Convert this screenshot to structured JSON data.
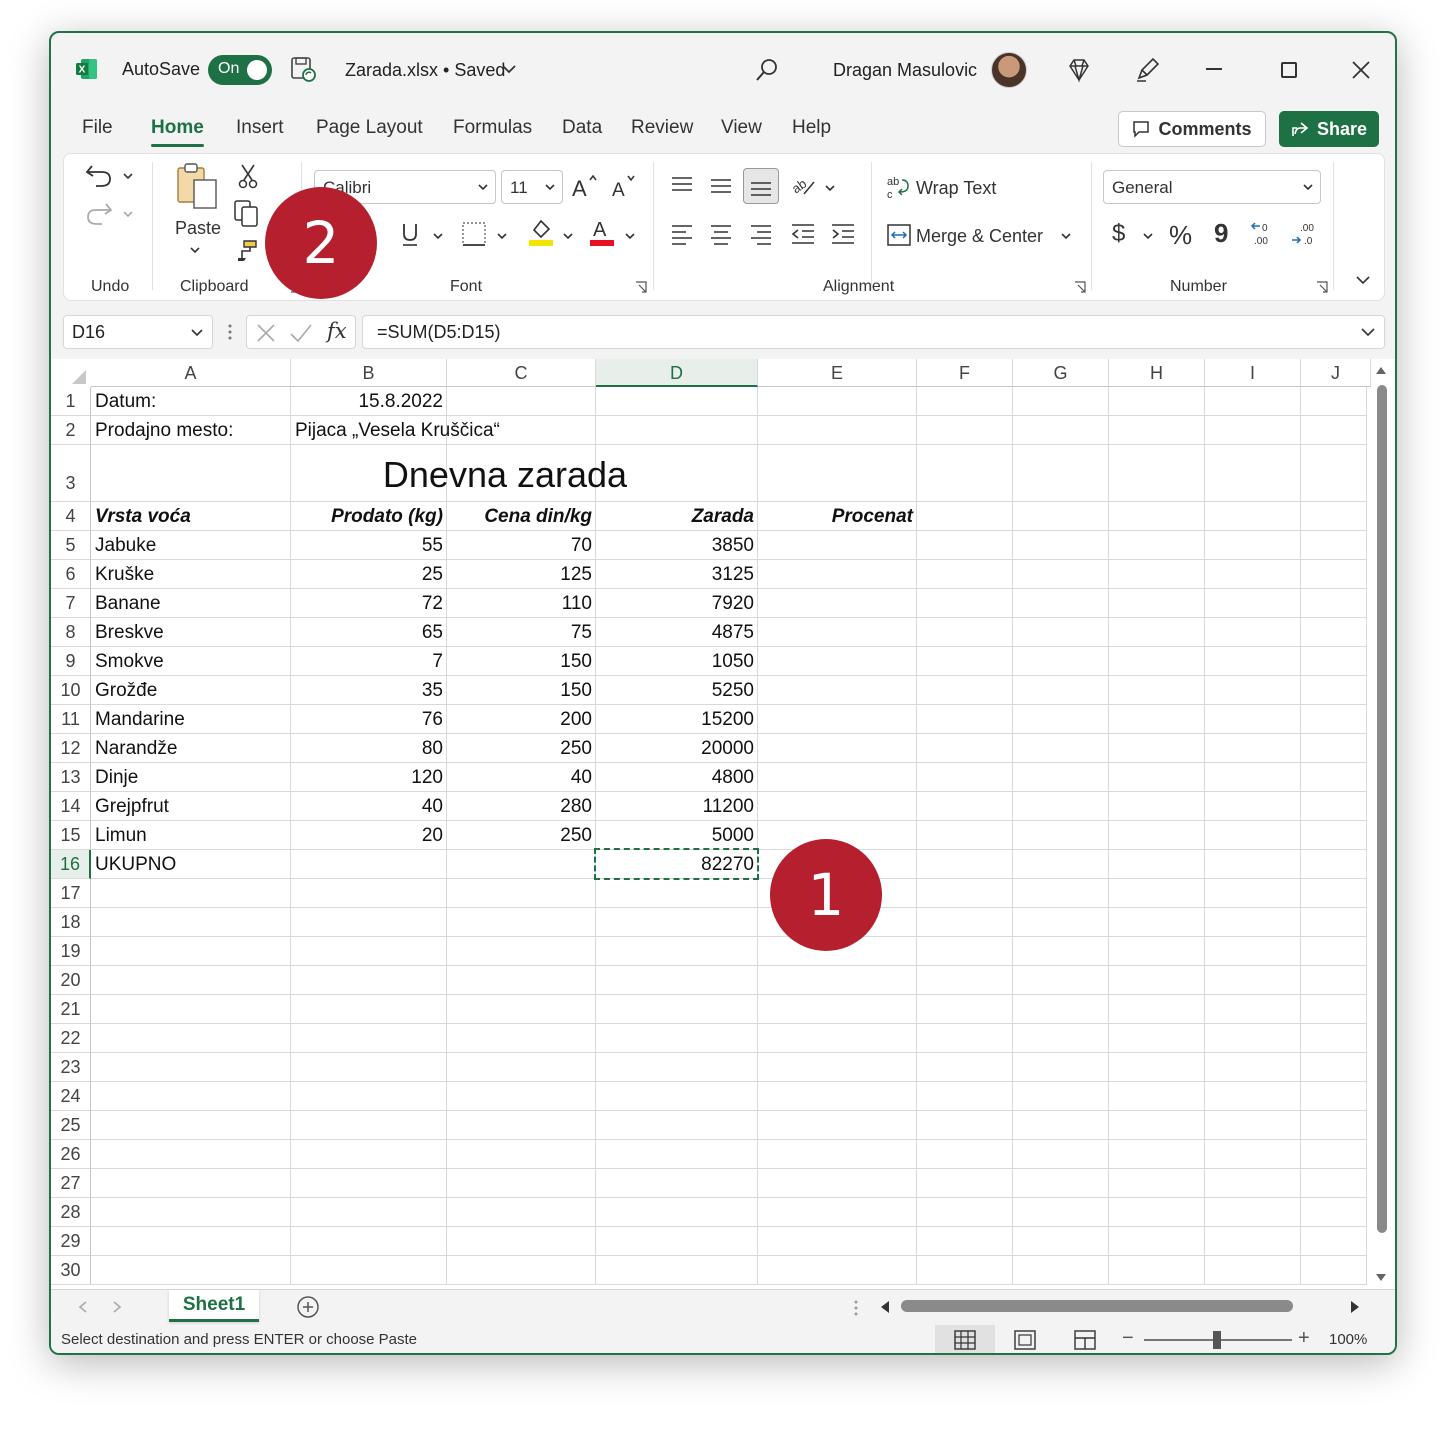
{
  "titlebar": {
    "autosave_label": "AutoSave",
    "autosave_state": "On",
    "filename": "Zarada.xlsx • Saved",
    "user": "Dragan Masulovic"
  },
  "menu": {
    "tabs": [
      "File",
      "Home",
      "Insert",
      "Page Layout",
      "Formulas",
      "Data",
      "Review",
      "View",
      "Help"
    ],
    "active": "Home",
    "comments_label": "Comments",
    "share_label": "Share"
  },
  "ribbon": {
    "undo_group": "Undo",
    "clipboard_group": "Clipboard",
    "paste_label": "Paste",
    "font_group": "Font",
    "font_name": "Calibri",
    "font_size": "11",
    "alignment_group": "Alignment",
    "wrap_text": "Wrap Text",
    "merge_center": "Merge & Center",
    "number_group": "Number",
    "number_format": "General",
    "currency_symbol": "$",
    "percent_symbol": "%",
    "comma_symbol": "9",
    "font_color": "#e81123",
    "fill_color": "#f2e600"
  },
  "formula_bar": {
    "name_box": "D16",
    "fx": "fx",
    "formula": "=SUM(D5:D15)"
  },
  "grid": {
    "columns": [
      "A",
      "B",
      "C",
      "D",
      "E",
      "F",
      "G",
      "H",
      "I",
      "J"
    ],
    "rows": [
      "1",
      "2",
      "3",
      "4",
      "5",
      "6",
      "7",
      "8",
      "9",
      "10",
      "11",
      "12",
      "13",
      "14",
      "15",
      "16",
      "17",
      "18",
      "19",
      "20",
      "21",
      "22",
      "23",
      "24",
      "25",
      "26",
      "27",
      "28",
      "29",
      "30"
    ],
    "selected_cell": "D16",
    "cells": {
      "A1": "Datum:",
      "B1": "15.8.2022",
      "A2": "Prodajno mesto:",
      "B2": "Pijaca „Vesela Kruščica“",
      "title": "Dnevna zarada",
      "A4": "Vrsta voća",
      "B4": "Prodato (kg)",
      "C4": "Cena din/kg",
      "D4": "Zarada",
      "E4": "Procenat",
      "A16": "UKUPNO",
      "D16": "82270"
    },
    "table": [
      [
        "Jabuke",
        "55",
        "70",
        "3850"
      ],
      [
        "Kruške",
        "25",
        "125",
        "3125"
      ],
      [
        "Banane",
        "72",
        "110",
        "7920"
      ],
      [
        "Breskve",
        "65",
        "75",
        "4875"
      ],
      [
        "Smokve",
        "7",
        "150",
        "1050"
      ],
      [
        "Grožđe",
        "35",
        "150",
        "5250"
      ],
      [
        "Mandarine",
        "76",
        "200",
        "15200"
      ],
      [
        "Narandže",
        "80",
        "250",
        "20000"
      ],
      [
        "Dinje",
        "120",
        "40",
        "4800"
      ],
      [
        "Grejpfrut",
        "40",
        "280",
        "11200"
      ],
      [
        "Limun",
        "20",
        "250",
        "5000"
      ]
    ]
  },
  "sheets": {
    "active": "Sheet1"
  },
  "status": {
    "message": "Select destination and press ENTER or choose Paste",
    "zoom": "100%"
  },
  "callouts": {
    "first": "1",
    "second": "2"
  }
}
